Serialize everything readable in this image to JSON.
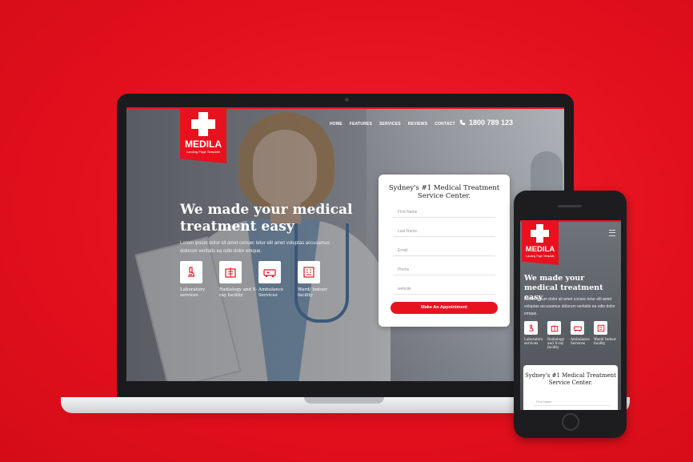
{
  "brand": {
    "name": "MEDILA",
    "tagline": "Landing Page Template",
    "accent_color": "#e8121f"
  },
  "nav": {
    "items": [
      "HOME",
      "FEATURES",
      "SERVICES",
      "REVIEWS",
      "CONTACT"
    ],
    "phone": "1800 789 123"
  },
  "hero": {
    "title": "We made your medical treatment easy",
    "text": "Lorem ipsum dolor sit amet consec tetur elit amet voluptas accusamus dolorum veritatis ea odio dolor emque."
  },
  "services": [
    {
      "label": "Laboratory services",
      "icon": "microscope-icon"
    },
    {
      "label": "Radiology and X-ray facility",
      "icon": "xray-icon"
    },
    {
      "label": "Ambulance Services",
      "icon": "ambulance-icon"
    },
    {
      "label": "Ward/ Indoor facility",
      "icon": "ward-icon"
    }
  ],
  "form": {
    "title": "Sydney's #1 Medical Treatment Service Center.",
    "fields": [
      "First Name",
      "Last Name",
      "Email",
      "Phone",
      "website"
    ],
    "submit_label": "Make An Appointment"
  },
  "mobile": {
    "hero_text": "Lorem ipsum dolor sit amet consec tetur elit amet voluptas accusamus dolorum veritatis ea odio dolor emque.",
    "first_field": "First Name"
  }
}
